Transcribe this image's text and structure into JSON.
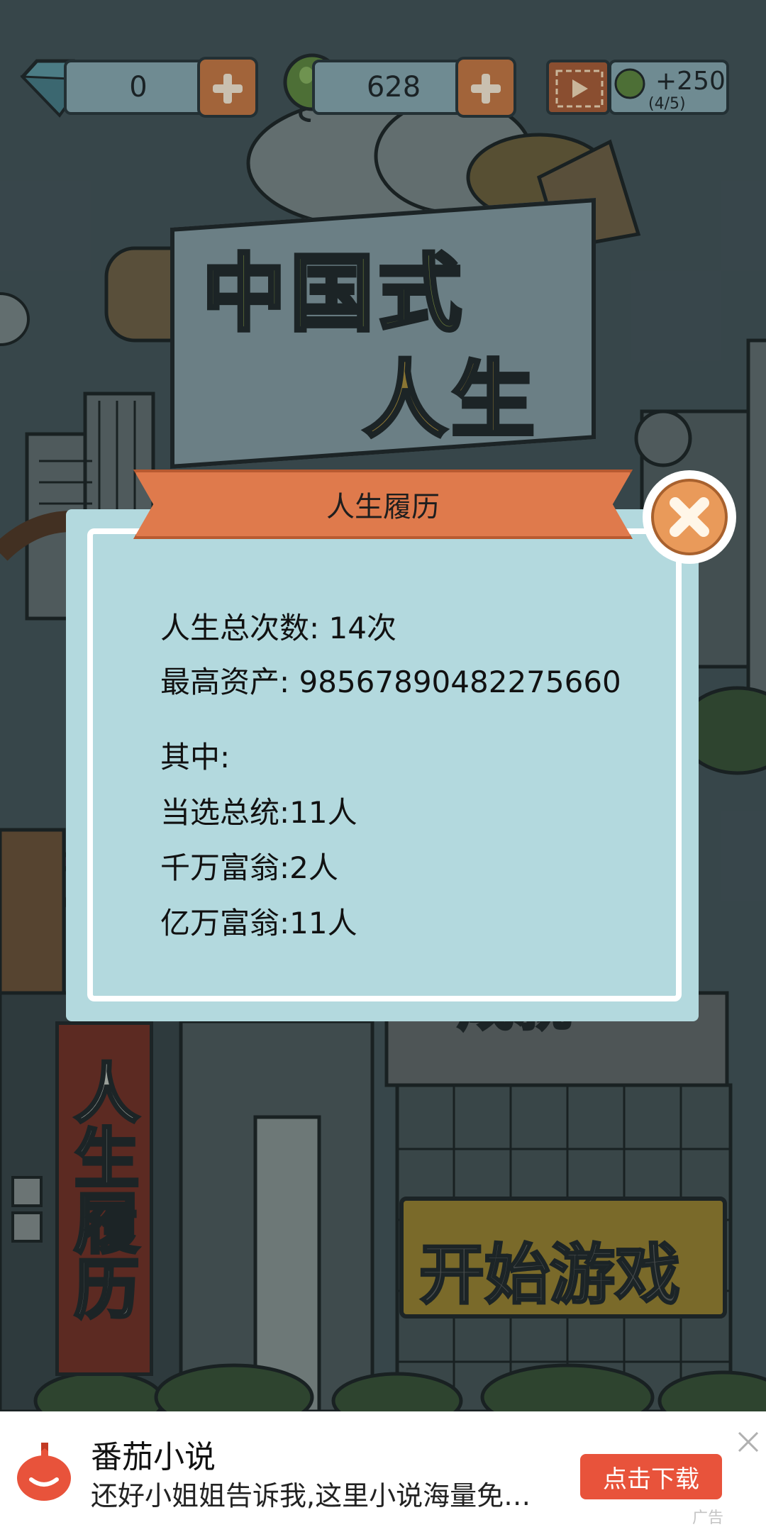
{
  "topbar": {
    "gems_count": "0",
    "leaf_count": "628",
    "video_reward": "+250",
    "video_reward_progress": "(4/5)"
  },
  "game_title": {
    "line1": "中国式",
    "line2": "人生"
  },
  "menu": {
    "history_button_label": "人生履历",
    "rank_button_label": "成就",
    "start_button_label": "开始游戏"
  },
  "modal": {
    "title": "人生履历",
    "total_lives_label": "人生总次数: 14次",
    "max_assets_label": "最高资产: 98567890482275660",
    "among_label": "其中:",
    "president_label": "当选总统:11人",
    "ten_million_label": "千万富翁:2人",
    "billionaire_label": "亿万富翁:11人"
  },
  "ad": {
    "app_name": "番茄小说",
    "description": "还好小姐姐告诉我,这里小说海量免费阅读",
    "cta_label": "点击下载",
    "tag": "广告"
  },
  "colors": {
    "modal_bg": "#b3d9de",
    "ribbon": "#df7a4c",
    "close_button": "#e99a5a",
    "ad_cta": "#e8533b"
  }
}
